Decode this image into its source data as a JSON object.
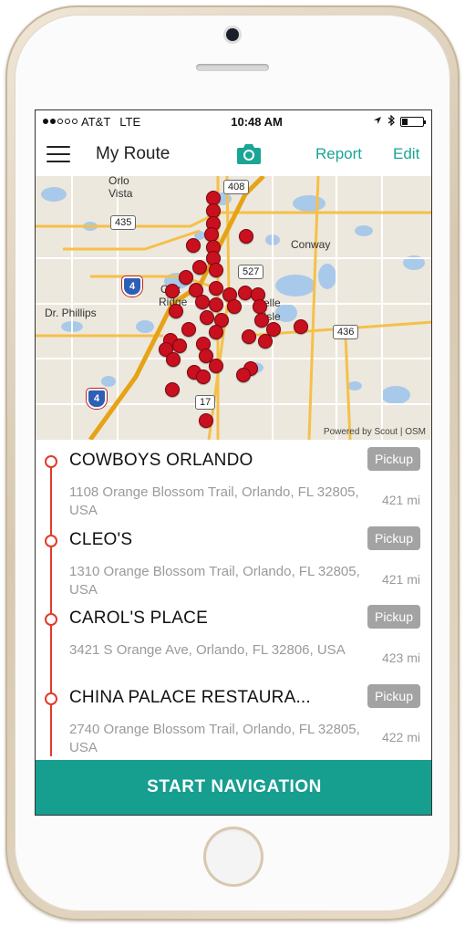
{
  "status": {
    "carrier": "AT&T",
    "network": "LTE",
    "time": "10:48 AM"
  },
  "header": {
    "title": "My Route",
    "report_label": "Report",
    "edit_label": "Edit",
    "accent_color": "#1aa595"
  },
  "map": {
    "labels": {
      "orlo_vista_1": "Orlo",
      "orlo_vista_2": "Vista",
      "conway": "Conway",
      "dr_phillips": "Dr. Phillips",
      "oak_ridge_1": "Oak",
      "oak_ridge_2": "Ridge",
      "belle_isle_1": "elle",
      "belle_isle_2": "Isle"
    },
    "route_shields": {
      "r408": "408",
      "r435": "435",
      "r527": "527",
      "r436": "436",
      "r17": "17",
      "i4_north": "4",
      "i4_south": "4"
    },
    "attribution": "Powered by Scout | OSM",
    "marker_color": "#c8101e"
  },
  "stops": [
    {
      "name": "COWBOYS ORLANDO",
      "action": "Pickup",
      "address": "1108 Orange Blossom Trail, Orlando, FL 32805, USA",
      "distance": "421 mi"
    },
    {
      "name": "CLEO'S",
      "action": "Pickup",
      "address": "1310 Orange Blossom Trail, Orlando, FL 32805, USA",
      "distance": "421 mi"
    },
    {
      "name": "CAROL'S PLACE",
      "action": "Pickup",
      "address": "3421 S Orange Ave, Orlando, FL 32806, USA",
      "distance": "423 mi"
    },
    {
      "name": "CHINA PALACE RESTAURA...",
      "action": "Pickup",
      "address": "2740 Orange Blossom Trail, Orlando, FL 32805, USA",
      "distance": "422 mi"
    }
  ],
  "footer": {
    "start_label": "START NAVIGATION",
    "color": "#169e8f"
  }
}
